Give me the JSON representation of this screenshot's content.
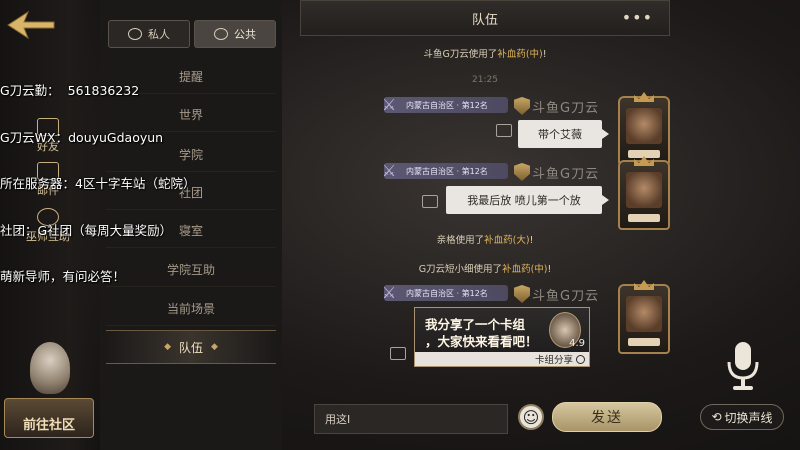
{
  "stream_overlay": {
    "lines": [
      "G刀云勤：  561836232",
      "G刀云WX：douyuGdaoyun",
      "所在服务器：4区十字车站（蛇院）",
      "社团：G社团（每周大量奖励）",
      "萌新导师，有问必答！"
    ]
  },
  "left_nav": {
    "items": [
      {
        "label": "好友",
        "icon": "friends-icon"
      },
      {
        "label": "邮件",
        "icon": "mail-icon"
      },
      {
        "label": "巫师互助",
        "icon": "wizard-help-icon"
      }
    ],
    "goto_community": "前往社区"
  },
  "channel_tabs": {
    "private": "私人",
    "public": "公共"
  },
  "channels": [
    "提醒",
    "世界",
    "学院",
    "社团",
    "寝室",
    "学院互助",
    "当前场景",
    "队伍"
  ],
  "active_channel": "队伍",
  "chat": {
    "title": "队伍",
    "more": "•••",
    "system_1": {
      "prefix": "斗鱼G刀云使用了",
      "item": "补血药(中)",
      "suffix": "!"
    },
    "timestamp": "21:25",
    "messages": [
      {
        "region": "内蒙古自治区 · 第12名",
        "sender": "斗鱼G刀云",
        "text": "带个艾薇"
      },
      {
        "region": "内蒙古自治区 · 第12名",
        "sender": "斗鱼G刀云",
        "text": "我最后放 喷儿第一个放"
      }
    ],
    "system_2": {
      "prefix": "亲格使用了",
      "item": "补血药(大)",
      "suffix": "!"
    },
    "system_3": {
      "prefix": "G刀云短小细使用了",
      "item": "补血药(中)",
      "suffix": "!"
    },
    "card_message": {
      "region": "内蒙古自治区 · 第12名",
      "sender": "斗鱼G刀云",
      "line1": "我分享了一个卡组",
      "line2": "，大家快来看看吧！",
      "score": "4.9",
      "footer": "卡组分享"
    }
  },
  "input": {
    "value": "用这I",
    "send_label": "发送"
  },
  "voice": {
    "switch_label": "切换声线"
  },
  "colors": {
    "accent_gold": "#c9a565",
    "item_orange": "#e0b45a",
    "region_purple": "#5c5873"
  }
}
